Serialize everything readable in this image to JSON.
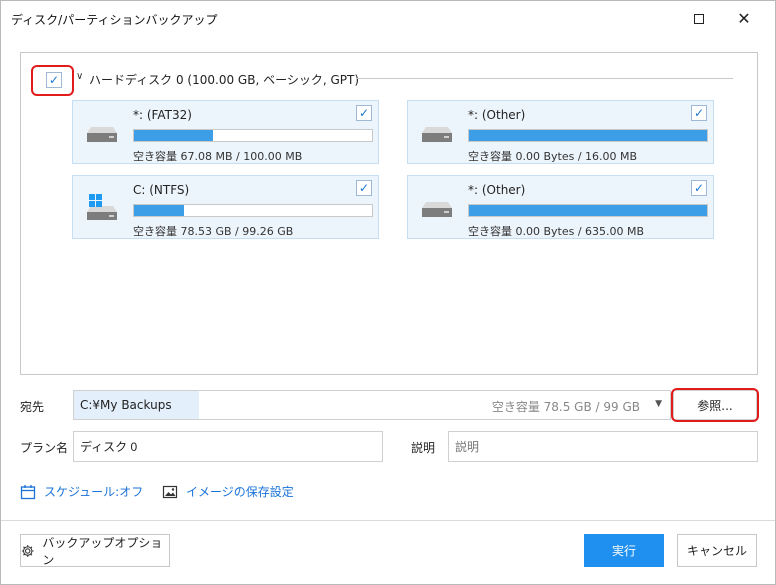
{
  "window": {
    "title": "ディスク/パーティションバックアップ",
    "maximize_icon": "maximize-icon",
    "close_icon": "close-icon",
    "close_glyph": "✕"
  },
  "disk": {
    "checked": true,
    "title": "ハードディスク 0 (100.00 GB, ベーシック, GPT)"
  },
  "partitions": [
    {
      "name": "*: (FAT32)",
      "checked": true,
      "used_fraction": 0.33,
      "free_text": "空き容量 67.08 MB / 100.00 MB",
      "icon": "drive-icon"
    },
    {
      "name": "*: (Other)",
      "checked": true,
      "used_fraction": 1.0,
      "free_text": "空き容量 0.00 Bytes / 16.00 MB",
      "icon": "drive-icon"
    },
    {
      "name": "C: (NTFS)",
      "checked": true,
      "used_fraction": 0.21,
      "free_text": "空き容量 78.53 GB / 99.26 GB",
      "icon": "windows-drive-icon"
    },
    {
      "name": "*: (Other)",
      "checked": true,
      "used_fraction": 1.0,
      "free_text": "空き容量 0.00 Bytes / 635.00 MB",
      "icon": "drive-icon"
    }
  ],
  "destination": {
    "label": "宛先",
    "path": "C:¥My Backups",
    "free_text": "空き容量 78.5 GB / 99 GB",
    "browse_label": "参照..."
  },
  "plan": {
    "label": "プラン名",
    "value": "ディスク 0"
  },
  "description": {
    "label": "説明",
    "placeholder": "説明"
  },
  "links": {
    "schedule": "スケジュール:オフ",
    "image_settings": "イメージの保存設定"
  },
  "footer": {
    "options_label": "バックアップオプション",
    "run_label": "実行",
    "cancel_label": "キャンセル"
  },
  "colors": {
    "accent": "#1f8ff0",
    "bar_fill": "#3c9ee7",
    "highlight": "#e21b1b",
    "link": "#1a73d9"
  }
}
